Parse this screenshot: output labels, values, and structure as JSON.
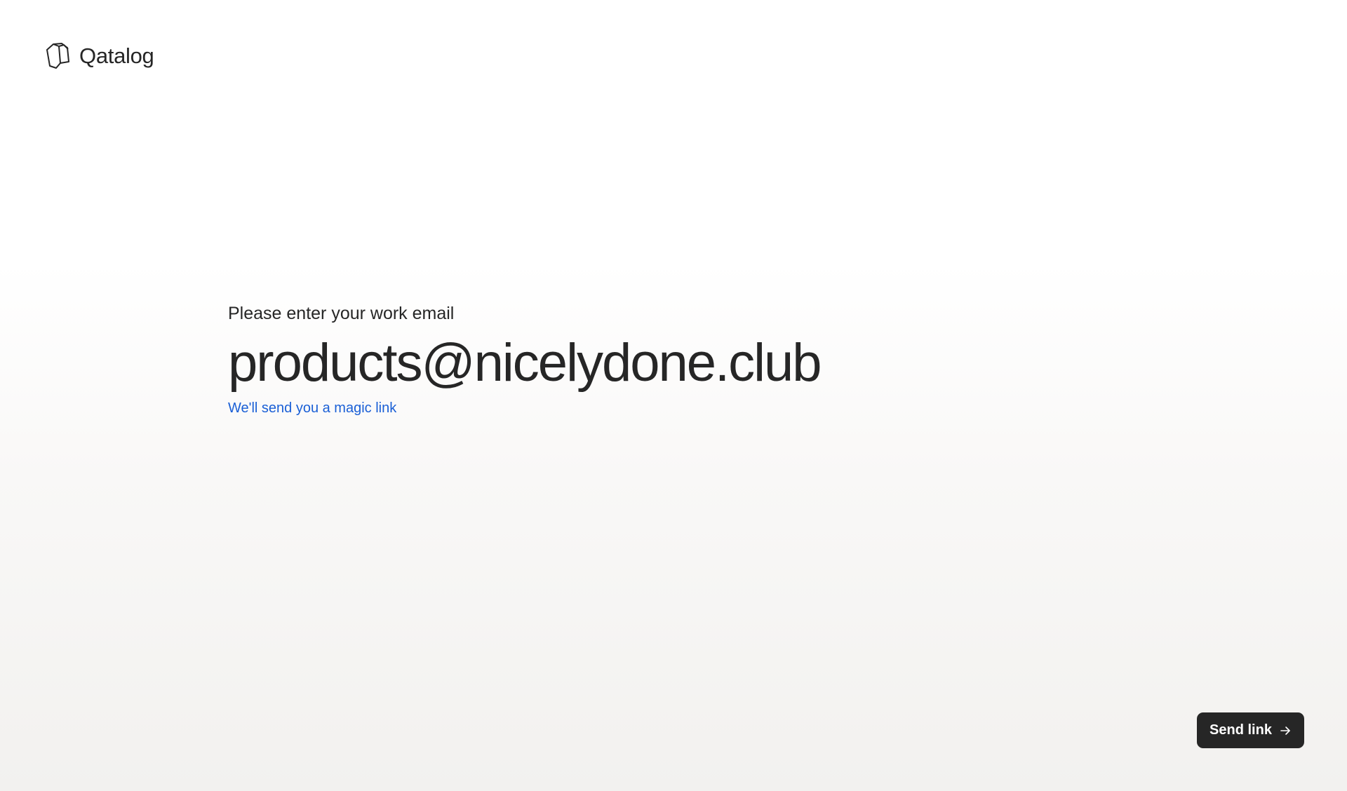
{
  "brand": {
    "name": "Qatalog",
    "icon": "stacked-hexagon-logo-icon"
  },
  "form": {
    "prompt_label": "Please enter your work email",
    "email_value": "products@nicelydone.club",
    "hint_link": "We'll send you a magic link"
  },
  "actions": {
    "send_label": "Send link",
    "send_icon": "arrow-right-icon"
  },
  "colors": {
    "text": "#262626",
    "link": "#1a5fd6",
    "button_bg": "#262626",
    "button_text": "#ffffff"
  }
}
